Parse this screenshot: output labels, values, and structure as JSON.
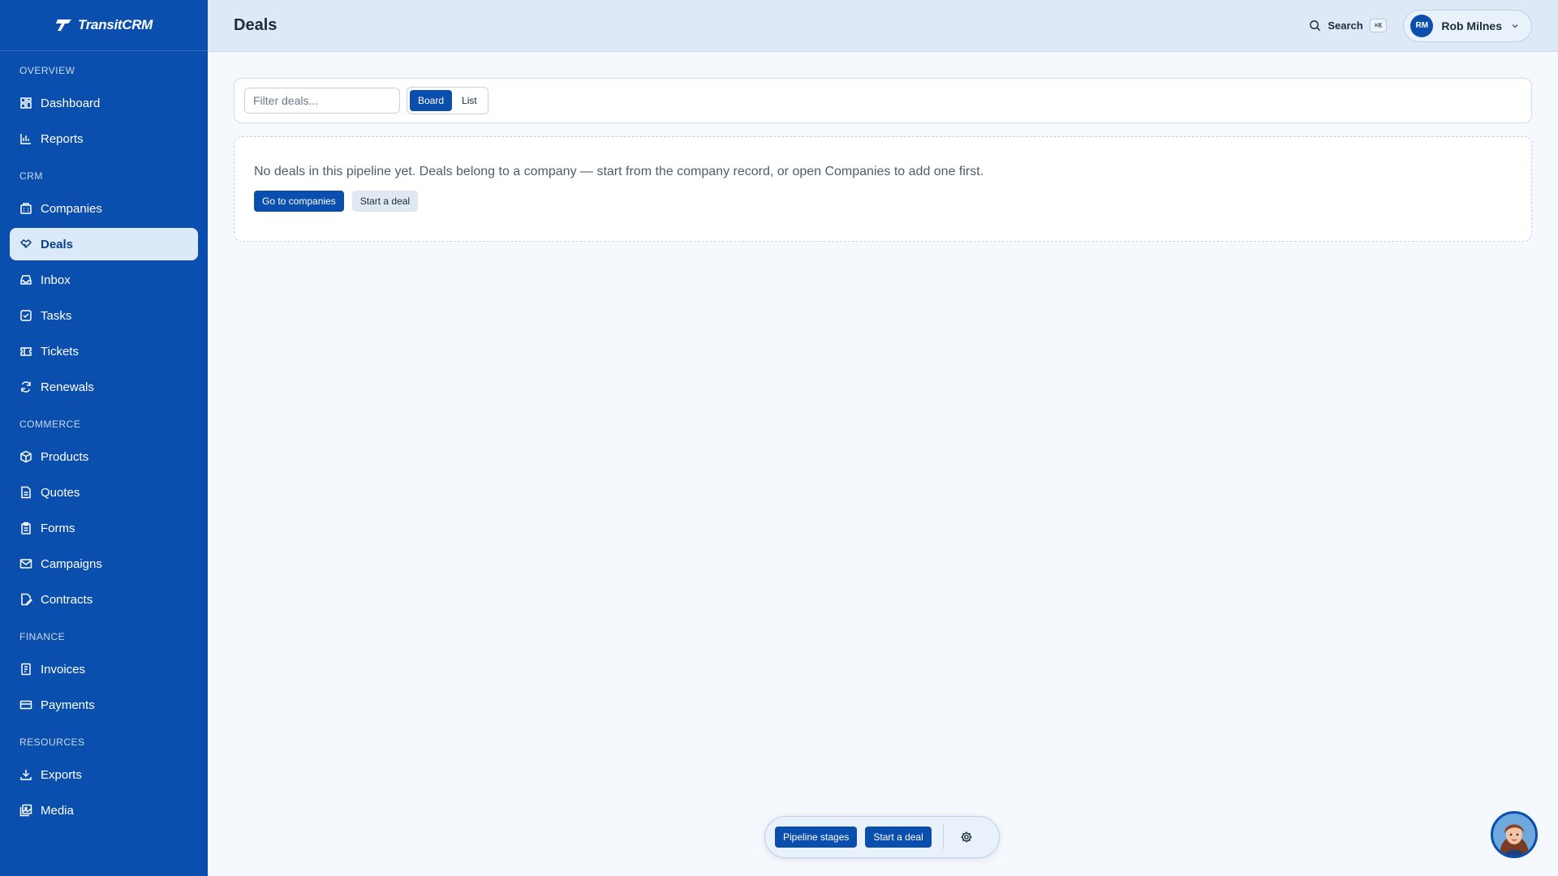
{
  "brand": {
    "name": "TransitCRM"
  },
  "sidebar": {
    "sections": [
      {
        "label": "OVERVIEW",
        "items": [
          {
            "label": "Dashboard",
            "icon": "grid-icon"
          },
          {
            "label": "Reports",
            "icon": "bar-chart-icon"
          }
        ]
      },
      {
        "label": "CRM",
        "items": [
          {
            "label": "Companies",
            "icon": "building-icon"
          },
          {
            "label": "Deals",
            "icon": "handshake-icon",
            "active": true
          },
          {
            "label": "Inbox",
            "icon": "inbox-icon"
          },
          {
            "label": "Tasks",
            "icon": "checkbox-icon"
          },
          {
            "label": "Tickets",
            "icon": "ticket-icon"
          },
          {
            "label": "Renewals",
            "icon": "refresh-icon"
          }
        ]
      },
      {
        "label": "COMMERCE",
        "items": [
          {
            "label": "Products",
            "icon": "box-icon"
          },
          {
            "label": "Quotes",
            "icon": "document-icon"
          },
          {
            "label": "Forms",
            "icon": "clipboard-icon"
          },
          {
            "label": "Campaigns",
            "icon": "mail-icon"
          },
          {
            "label": "Contracts",
            "icon": "contract-icon"
          }
        ]
      },
      {
        "label": "FINANCE",
        "items": [
          {
            "label": "Invoices",
            "icon": "invoice-icon"
          },
          {
            "label": "Payments",
            "icon": "credit-card-icon"
          }
        ]
      },
      {
        "label": "RESOURCES",
        "items": [
          {
            "label": "Exports",
            "icon": "download-icon"
          },
          {
            "label": "Media",
            "icon": "image-icon"
          }
        ]
      }
    ]
  },
  "header": {
    "title": "Deals",
    "search_label": "Search",
    "search_shortcut": "⌘K",
    "user": {
      "initials": "RM",
      "name": "Rob Milnes"
    }
  },
  "toolbar": {
    "filter_placeholder": "Filter deals...",
    "view_board": "Board",
    "view_list": "List"
  },
  "empty_state": {
    "message": "No deals in this pipeline yet. Deals belong to a company — start from the company record, or open Companies to add one first.",
    "primary_label": "Go to companies",
    "secondary_label": "Start a deal"
  },
  "float_bar": {
    "pipeline_label": "Pipeline stages",
    "start_label": "Start a deal"
  },
  "colors": {
    "sidebar": "#0a4fad",
    "accent": "#0a4fad",
    "header": "#dde9f7",
    "active_item": "#dce9f9"
  }
}
